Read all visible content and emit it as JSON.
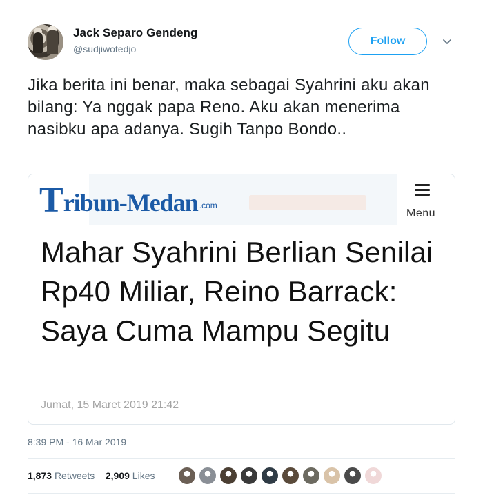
{
  "user": {
    "name": "Jack Separo Gendeng",
    "handle": "@sudjiwotedjo"
  },
  "follow_label": "Follow",
  "tweet_text": "Jika berita ini benar, maka sebagai Syahrini aku akan bilang: Ya nggak papa Reno. Aku akan menerima nasibku apa adanya. Sugih Tanpo Bondo..",
  "card": {
    "logo_t": "T",
    "logo_rest": "ribun-Medan",
    "logo_com": ".com",
    "menu_label": "Menu",
    "headline": "Mahar Syahrini Berlian Senilai Rp40 Miliar, Reino Barrack: Saya Cuma Mampu Segitu",
    "date": "Jumat, 15 Maret 2019 21:42"
  },
  "timestamp": "8:39 PM - 16 Mar 2019",
  "stats": {
    "retweets_count": "1,873",
    "retweets_label": "Retweets",
    "likes_count": "2,909",
    "likes_label": "Likes"
  },
  "colors": {
    "accent": "#1da1f2",
    "logo_blue": "#1b5aa6"
  },
  "liker_avatars": [
    "#6b5f55",
    "#8a8f96",
    "#4b3f33",
    "#3a3a3a",
    "#2f3b45",
    "#5a4a3a",
    "#6c6a60",
    "#d9c3a8",
    "#4a4a4a",
    "#f0d8d8"
  ]
}
